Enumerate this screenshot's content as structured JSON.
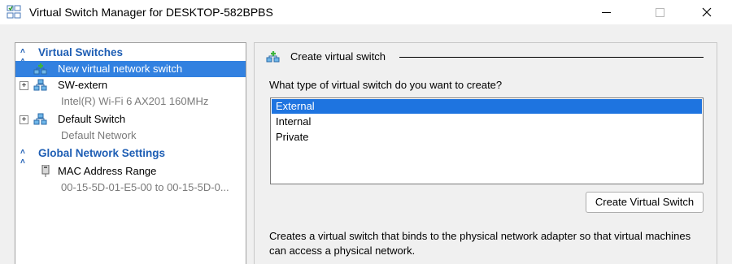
{
  "window": {
    "title": "Virtual Switch Manager for DESKTOP-582BPBS",
    "icon": "virtual-switch-manager-icon"
  },
  "tree": {
    "sections": [
      {
        "label": "Virtual Switches",
        "items": [
          {
            "label": "New virtual network switch",
            "selected": true,
            "icon": "add-network-icon"
          },
          {
            "label": "SW-extern",
            "sublabel": "Intel(R) Wi-Fi 6 AX201 160MHz",
            "icon": "network-switch-icon",
            "expander": "+"
          },
          {
            "label": "Default Switch",
            "sublabel": "Default Network",
            "icon": "network-switch-icon",
            "expander": "+"
          }
        ]
      },
      {
        "label": "Global Network Settings",
        "items": [
          {
            "label": "MAC Address Range",
            "sublabel": "00-15-5D-01-E5-00 to 00-15-5D-0...",
            "icon": "mac-address-icon"
          }
        ]
      }
    ]
  },
  "panel": {
    "header": "Create virtual switch",
    "question": "What type of virtual switch do you want to create?",
    "options": [
      "External",
      "Internal",
      "Private"
    ],
    "selected_option": "External",
    "button_label": "Create Virtual Switch",
    "description": "Creates a virtual switch that binds to the physical network adapter so that virtual machines can access a physical network."
  },
  "colors": {
    "section_header": "#1e5eb4",
    "selection": "#3281e0",
    "list_selection": "#1e74e0"
  }
}
